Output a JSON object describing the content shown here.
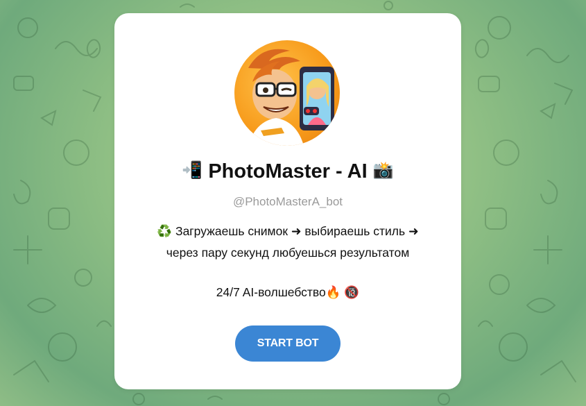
{
  "bot": {
    "title_prefix_icon": "mobile-phone-arrow-emoji",
    "title_prefix_glyph": "📲",
    "name": "PhotoMaster - AI",
    "title_suffix_icon": "camera-flash-emoji",
    "title_suffix_glyph": "📸",
    "username": "@PhotoMasterA_bot",
    "avatar_icon": "cartoon-man-with-phone-avatar"
  },
  "description": {
    "recycle_glyph": "♻️",
    "line1": "Загружаешь снимок ➜ выбираешь стиль ➜",
    "line2": "через пару секунд любуешься результатом",
    "tagline": "24/7 AI-волшебство",
    "fire_glyph": "🔥",
    "adult_glyph": "🔞"
  },
  "actions": {
    "start_label": "START BOT"
  },
  "colors": {
    "accent": "#3b86d4",
    "card_bg": "#ffffff",
    "username": "#9a9a9a",
    "background": "#8fbf84"
  }
}
